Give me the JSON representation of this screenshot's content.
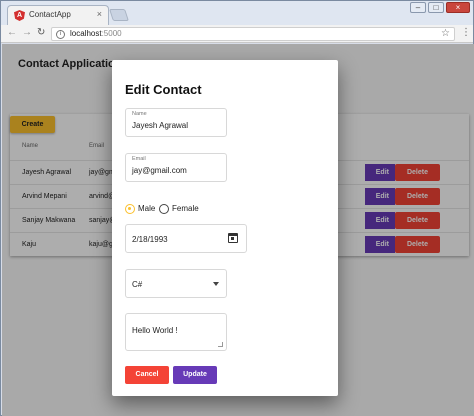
{
  "browser": {
    "tab_title": "ContactApp",
    "tab_close": "×",
    "url_host": "localhost",
    "url_port": ":5000",
    "window_controls": {
      "minimize": "–",
      "maximize": "□",
      "close": "×"
    }
  },
  "app": {
    "title": "Contact Application",
    "create_label": "Create",
    "columns": [
      "Name",
      "Email"
    ],
    "rows": [
      {
        "name": "Jayesh Agrawal",
        "email": "jay@gm"
      },
      {
        "name": "Arvind Mepani",
        "email": "arvind@"
      },
      {
        "name": "Sanjay Makwana",
        "email": "sanjay@"
      },
      {
        "name": "Kaju",
        "email": "kaju@gm"
      }
    ],
    "edit_label": "Edit",
    "delete_label": "Delete"
  },
  "dialog": {
    "title": "Edit Contact",
    "name": {
      "label": "Name",
      "value": "Jayesh Agrawal"
    },
    "email": {
      "label": "Email",
      "value": "jay@gmail.com"
    },
    "gender": {
      "options": [
        "Male",
        "Female"
      ],
      "selected": "Male"
    },
    "dob": {
      "value": "2/18/1993"
    },
    "skill": {
      "value": "C#"
    },
    "message": {
      "value": "Hello World !"
    },
    "cancel_label": "Cancel",
    "update_label": "Update"
  },
  "colors": {
    "accent": "#fbc02d",
    "primary": "#673ab7",
    "warn": "#f44336"
  }
}
